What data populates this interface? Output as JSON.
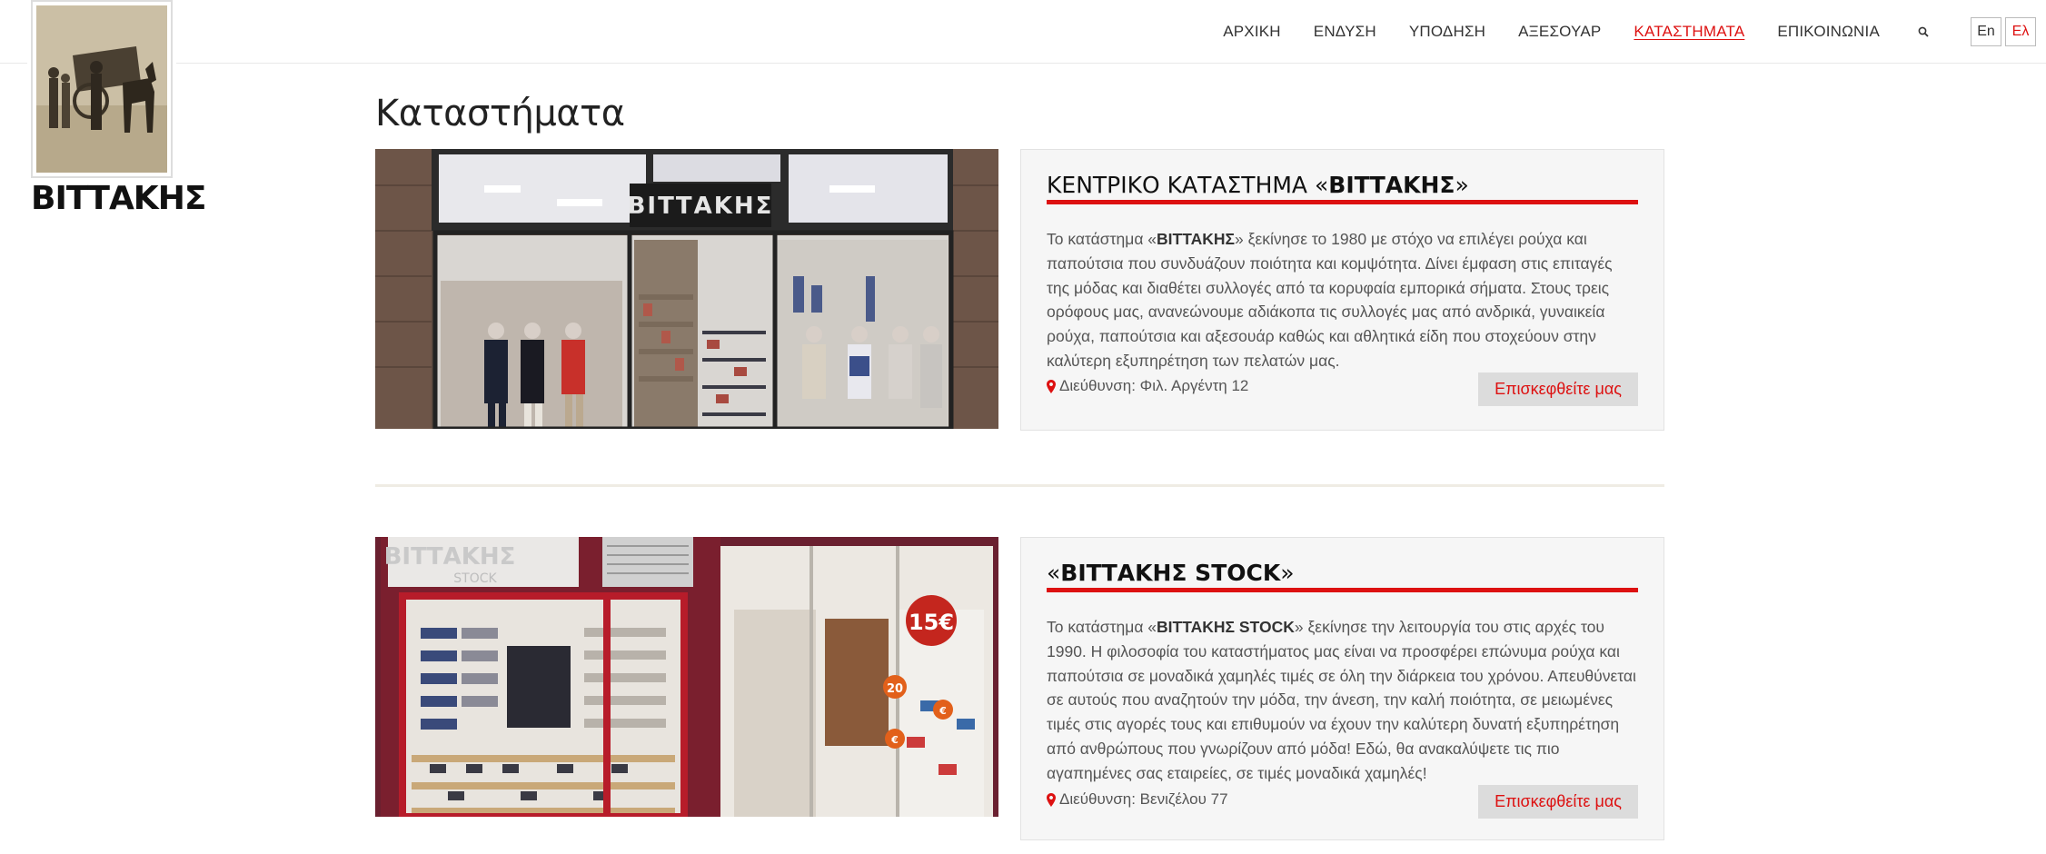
{
  "logo": {
    "text": "ΒΙΤΤΑΚΗΣ",
    "icon": "vintage-photo-logo"
  },
  "nav": {
    "items": [
      {
        "label": "ΑΡΧΙΚΗ",
        "active": false
      },
      {
        "label": "ΕΝΔΥΣΗ",
        "active": false
      },
      {
        "label": "ΥΠΟΔΗΣΗ",
        "active": false
      },
      {
        "label": "ΑΞΕΣΟΥΑΡ",
        "active": false
      },
      {
        "label": "ΚΑΤΑΣΤΗΜΑΤΑ",
        "active": true
      },
      {
        "label": "ΕΠΙΚΟΙΝΩΝΙΑ",
        "active": false
      }
    ],
    "search_icon": "search-icon",
    "languages": [
      {
        "label": "En",
        "active": false
      },
      {
        "label": "Ελ",
        "active": true
      }
    ]
  },
  "page": {
    "title": "Καταστήματα"
  },
  "stores": [
    {
      "name_prefix": "ΚΕΝΤΡΙΚΟ ΚΑΤΑΣΤΗΜΑ «",
      "name_bold": "ΒΙΤΤΑΚΗΣ",
      "name_suffix": "»",
      "desc_prefix": "Το κατάστημα «",
      "desc_bold": "ΒΙΤΤΑΚΗΣ",
      "desc_rest": "» ξεκίνησε το 1980 με στόχο να επιλέγει ρούχα και παπούτσια που συνδυάζουν ποιότητα και κομψότητα. Δίνει έμφαση στις επιταγές της μόδας και διαθέτει συλλογές από τα κορυφαία εμπορικά σήματα. Στους τρεις ορόφους μας, ανανεώνουμε αδιάκοπα τις συλλογές μας από ανδρικά, γυναικεία ρούχα, παπούτσια και αξεσουάρ καθώς και αθλητικά είδη που στοχεύουν στην καλύτερη εξυπηρέτηση των πελατών μας.",
      "address": "Διεύθυνση: Φιλ. Αργέντη 12",
      "button": "Επισκεφθείτε μας",
      "sign_text": "ΒΙΤΤΑΚΗΣ"
    },
    {
      "name_prefix": "«",
      "name_bold": "ΒΙΤΤΑΚΗΣ STOCK",
      "name_suffix": "»",
      "desc_prefix": "Το κατάστημα «",
      "desc_bold": "ΒΙΤΤΑΚΗΣ STOCK",
      "desc_rest": "» ξεκίνησε την λειτουργία του στις αρχές του 1990. Η φιλοσοφία του καταστήματος μας είναι να προσφέρει επώνυμα ρούχα και παπούτσια σε μοναδικά χαμηλές τιμές σε όλη την διάρκεια του χρόνου. Απευθύνεται σε αυτούς που αναζητούν την μόδα, την άνεση, την καλή ποιότητα, σε μειωμένες τιμές στις αγορές τους και επιθυμούν να έχουν την καλύτερη δυνατή εξυπηρέτηση από ανθρώπους που γνωρίζουν από μόδα! Εδώ, θα ανακαλύψετε τις πιο αγαπημένες σας εταιρείες, σε τιμές μοναδικά χαμηλές!",
      "address": "Διεύθυνση: Βενιζέλου 77",
      "button": "Επισκεφθείτε μας",
      "sign_text": "ΒΙΤΤΑΚΗΣ",
      "sign_sub": "STOCK",
      "price_badge": "15€",
      "price_badge_small_1": "20",
      "price_badge_small_2": "€",
      "price_badge_small_3": "€"
    }
  ],
  "colors": {
    "accent": "#d11111",
    "card_bg": "#f6f6f6",
    "button_bg": "#dcdcdc"
  }
}
